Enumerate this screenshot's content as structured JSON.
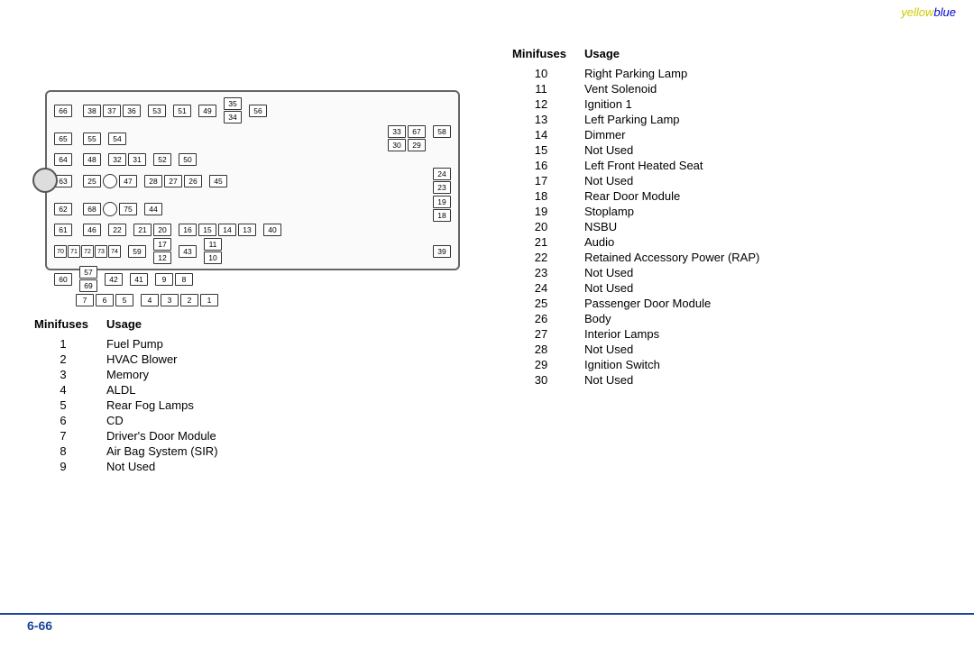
{
  "brand": {
    "yellow": "yellow",
    "blue": "blue"
  },
  "footer": {
    "page": "6-66"
  },
  "left_table": {
    "col1_header": "Minifuses",
    "col2_header": "Usage",
    "rows": [
      {
        "num": "1",
        "usage": "Fuel Pump"
      },
      {
        "num": "2",
        "usage": "HVAC Blower"
      },
      {
        "num": "3",
        "usage": "Memory"
      },
      {
        "num": "4",
        "usage": "ALDL"
      },
      {
        "num": "5",
        "usage": "Rear Fog Lamps"
      },
      {
        "num": "6",
        "usage": "CD"
      },
      {
        "num": "7",
        "usage": "Driver's Door Module"
      },
      {
        "num": "8",
        "usage": "Air Bag System (SIR)"
      },
      {
        "num": "9",
        "usage": "Not Used"
      }
    ]
  },
  "right_table": {
    "col1_header": "Minifuses",
    "col2_header": "Usage",
    "rows": [
      {
        "num": "10",
        "usage": "Right Parking Lamp"
      },
      {
        "num": "11",
        "usage": "Vent Solenoid"
      },
      {
        "num": "12",
        "usage": "Ignition 1"
      },
      {
        "num": "13",
        "usage": "Left Parking Lamp"
      },
      {
        "num": "14",
        "usage": "Dimmer"
      },
      {
        "num": "15",
        "usage": "Not Used"
      },
      {
        "num": "16",
        "usage": "Left Front Heated Seat"
      },
      {
        "num": "17",
        "usage": "Not Used"
      },
      {
        "num": "18",
        "usage": "Rear Door Module"
      },
      {
        "num": "19",
        "usage": "Stoplamp"
      },
      {
        "num": "20",
        "usage": "NSBU"
      },
      {
        "num": "21",
        "usage": "Audio"
      },
      {
        "num": "22",
        "usage": "Retained Accessory Power (RAP)"
      },
      {
        "num": "23",
        "usage": "Not Used"
      },
      {
        "num": "24",
        "usage": "Not Used"
      },
      {
        "num": "25",
        "usage": "Passenger Door Module"
      },
      {
        "num": "26",
        "usage": "Body"
      },
      {
        "num": "27",
        "usage": "Interior Lamps"
      },
      {
        "num": "28",
        "usage": "Not Used"
      },
      {
        "num": "29",
        "usage": "Ignition Switch"
      },
      {
        "num": "30",
        "usage": "Not Used"
      }
    ]
  }
}
